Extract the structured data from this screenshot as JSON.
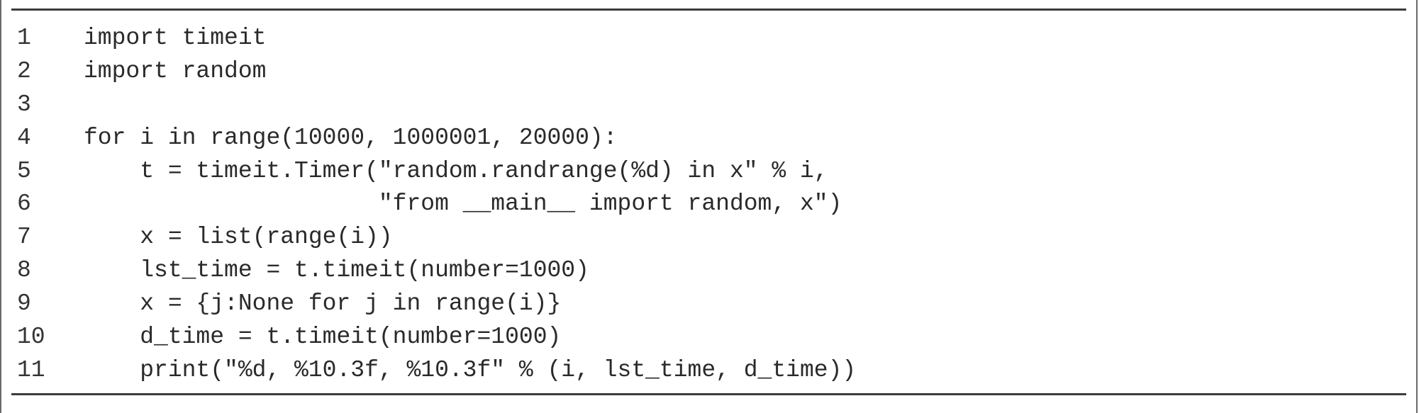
{
  "code": {
    "lines": [
      {
        "n": "1",
        "text": "import timeit"
      },
      {
        "n": "2",
        "text": "import random"
      },
      {
        "n": "3",
        "text": ""
      },
      {
        "n": "4",
        "text": "for i in range(10000, 1000001, 20000):"
      },
      {
        "n": "5",
        "text": "    t = timeit.Timer(\"random.randrange(%d) in x\" % i,"
      },
      {
        "n": "6",
        "text": "                     \"from __main__ import random, x\")"
      },
      {
        "n": "7",
        "text": "    x = list(range(i))"
      },
      {
        "n": "8",
        "text": "    lst_time = t.timeit(number=1000)"
      },
      {
        "n": "9",
        "text": "    x = {j:None for j in range(i)}"
      },
      {
        "n": "10",
        "text": "    d_time = t.timeit(number=1000)"
      },
      {
        "n": "11",
        "text": "    print(\"%d, %10.3f, %10.3f\" % (i, lst_time, d_time))"
      }
    ]
  }
}
